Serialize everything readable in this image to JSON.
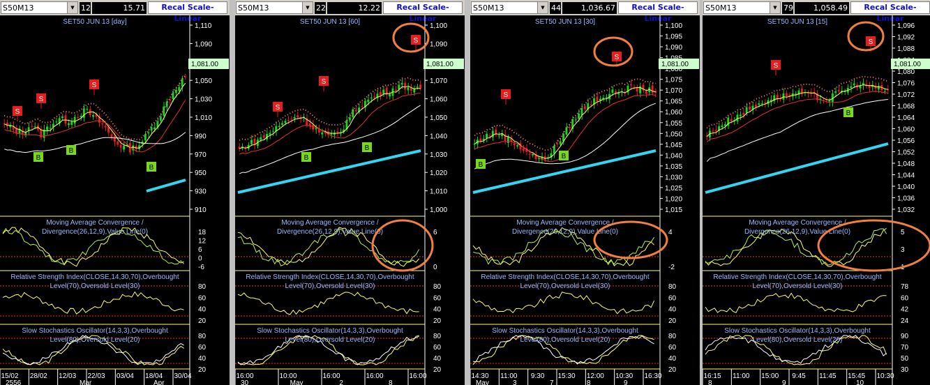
{
  "colors": {
    "bg": "#000000",
    "candle_up": "#19d619",
    "candle_down": "#e81d1d",
    "title": "#9ab8ff",
    "axis_text": "#ffffff",
    "ema_fast": "#ffff66",
    "ema_mid": "#e83030",
    "ema_slow": "#ffffff",
    "ema_long": "#33d6f2",
    "sar": "#ff8080",
    "annot": "#f08040",
    "price_badge": "#ccffcc",
    "sell_marker": "#e81d1d",
    "buy_marker": "#7ad81a"
  },
  "panels": [
    {
      "symbol": "S50M13",
      "num_label": "12",
      "price_field": "15.71",
      "recal_label": "Recal Scale-Linear",
      "chart_title": "SET50 JUN 13   [day]",
      "last_price": "1,081.00",
      "price_ticks": [
        "1,110",
        "1,090",
        "1,070",
        "1,050",
        "1,030",
        "1,010",
        "990",
        "970",
        "950",
        "930",
        "910"
      ],
      "macd_ticks": [
        "18",
        "12",
        "6",
        "0",
        "-6"
      ],
      "rsi_ticks": [
        "80",
        "60",
        "40",
        "20"
      ],
      "stoch_ticks": [
        "80",
        "60",
        "40",
        "20"
      ],
      "time_labels": [
        "15/02",
        "28/02",
        "12/03",
        "22/03",
        "03/04",
        "18/04",
        "30/04"
      ],
      "bottom_labels": [
        "2556",
        "Mar",
        "Apr"
      ]
    },
    {
      "symbol": "S50M13",
      "num_label": "22",
      "price_field": "12.22",
      "recal_label": "Recal Scale-Linear",
      "chart_title": "SET50 JUN 13   [60]",
      "last_price": "1,081.00",
      "price_ticks": [
        "1,100",
        "1,090",
        "1,080",
        "1,070",
        "1,060",
        "1,050",
        "1,040",
        "1,030",
        "1,020",
        "1,010",
        "1,000"
      ],
      "macd_ticks": [
        "6",
        "0"
      ],
      "rsi_ticks": [
        "80",
        "60",
        "40",
        "20"
      ],
      "stoch_ticks": [
        "80",
        "60",
        "40",
        "20"
      ],
      "time_labels": [
        "16:00",
        "10:00",
        "16:00",
        "16:00",
        "16:00"
      ],
      "bottom_labels": [
        "30",
        "May",
        "2",
        "8"
      ]
    },
    {
      "symbol": "S50M13",
      "num_label": "44",
      "price_field": "1,036.67",
      "recal_label": "Recal Scale-Linear",
      "chart_title": "SET50 JUN 13   [30]",
      "last_price": "1,081.00",
      "price_ticks": [
        "1,100",
        "1,095",
        "1,090",
        "1,085",
        "1,080",
        "1,075",
        "1,070",
        "1,065",
        "1,060",
        "1,055",
        "1,050",
        "1,045",
        "1,040",
        "1,035",
        "1,030",
        "1,025",
        "1,020",
        "1,015"
      ],
      "macd_ticks": [
        "4",
        "-2"
      ],
      "rsi_ticks": [
        "80",
        "60",
        "40",
        "20"
      ],
      "stoch_ticks": [
        "80",
        "60",
        "40",
        "20"
      ],
      "time_labels": [
        "14:30",
        "11:00",
        "9:30",
        "15:30",
        "12:00",
        "10:30",
        "16:30"
      ],
      "bottom_labels": [
        "May",
        "3",
        "7",
        "8",
        "9"
      ]
    },
    {
      "symbol": "S50M13",
      "num_label": "79",
      "price_field": "1,058.49",
      "recal_label": "Recal Scale-Linear",
      "chart_title": "SET50 JUN 13   [15]",
      "last_price": "1,081.00",
      "price_ticks": [
        "1,096",
        "1,092",
        "1,088",
        "1,084",
        "1,080",
        "1,076",
        "1,072",
        "1,068",
        "1,064",
        "1,060",
        "1,056",
        "1,052",
        "1,048",
        "1,044",
        "1,040",
        "1,036",
        "1,032"
      ],
      "macd_ticks": [
        "5",
        "3",
        "1"
      ],
      "rsi_ticks": [
        "78",
        "60",
        "42",
        "24"
      ],
      "stoch_ticks": [
        "90",
        "70",
        "50",
        "30"
      ],
      "time_labels": [
        "16:15",
        "11:00",
        "15:00",
        "9:45",
        "11:45",
        "15:45",
        "10:30"
      ],
      "bottom_labels": [
        "8",
        "9",
        "10"
      ]
    }
  ],
  "indicator_titles": {
    "macd_l1": "Moving Average Convergence /",
    "macd_l2": "Divergence(26,12,9),Value Line(0)",
    "rsi_l1": "Relative Strength Index(CLOSE,14,30,70),Overbought",
    "rsi_l2": "Level(70),Oversold Level(30)",
    "stoch_l1": "Slow Stochastics Oscillator(14,3,3),Overbought",
    "stoch_l2": "Level(80),Oversold Level(20)"
  },
  "markers": {
    "sell": "S",
    "buy": "B"
  }
}
